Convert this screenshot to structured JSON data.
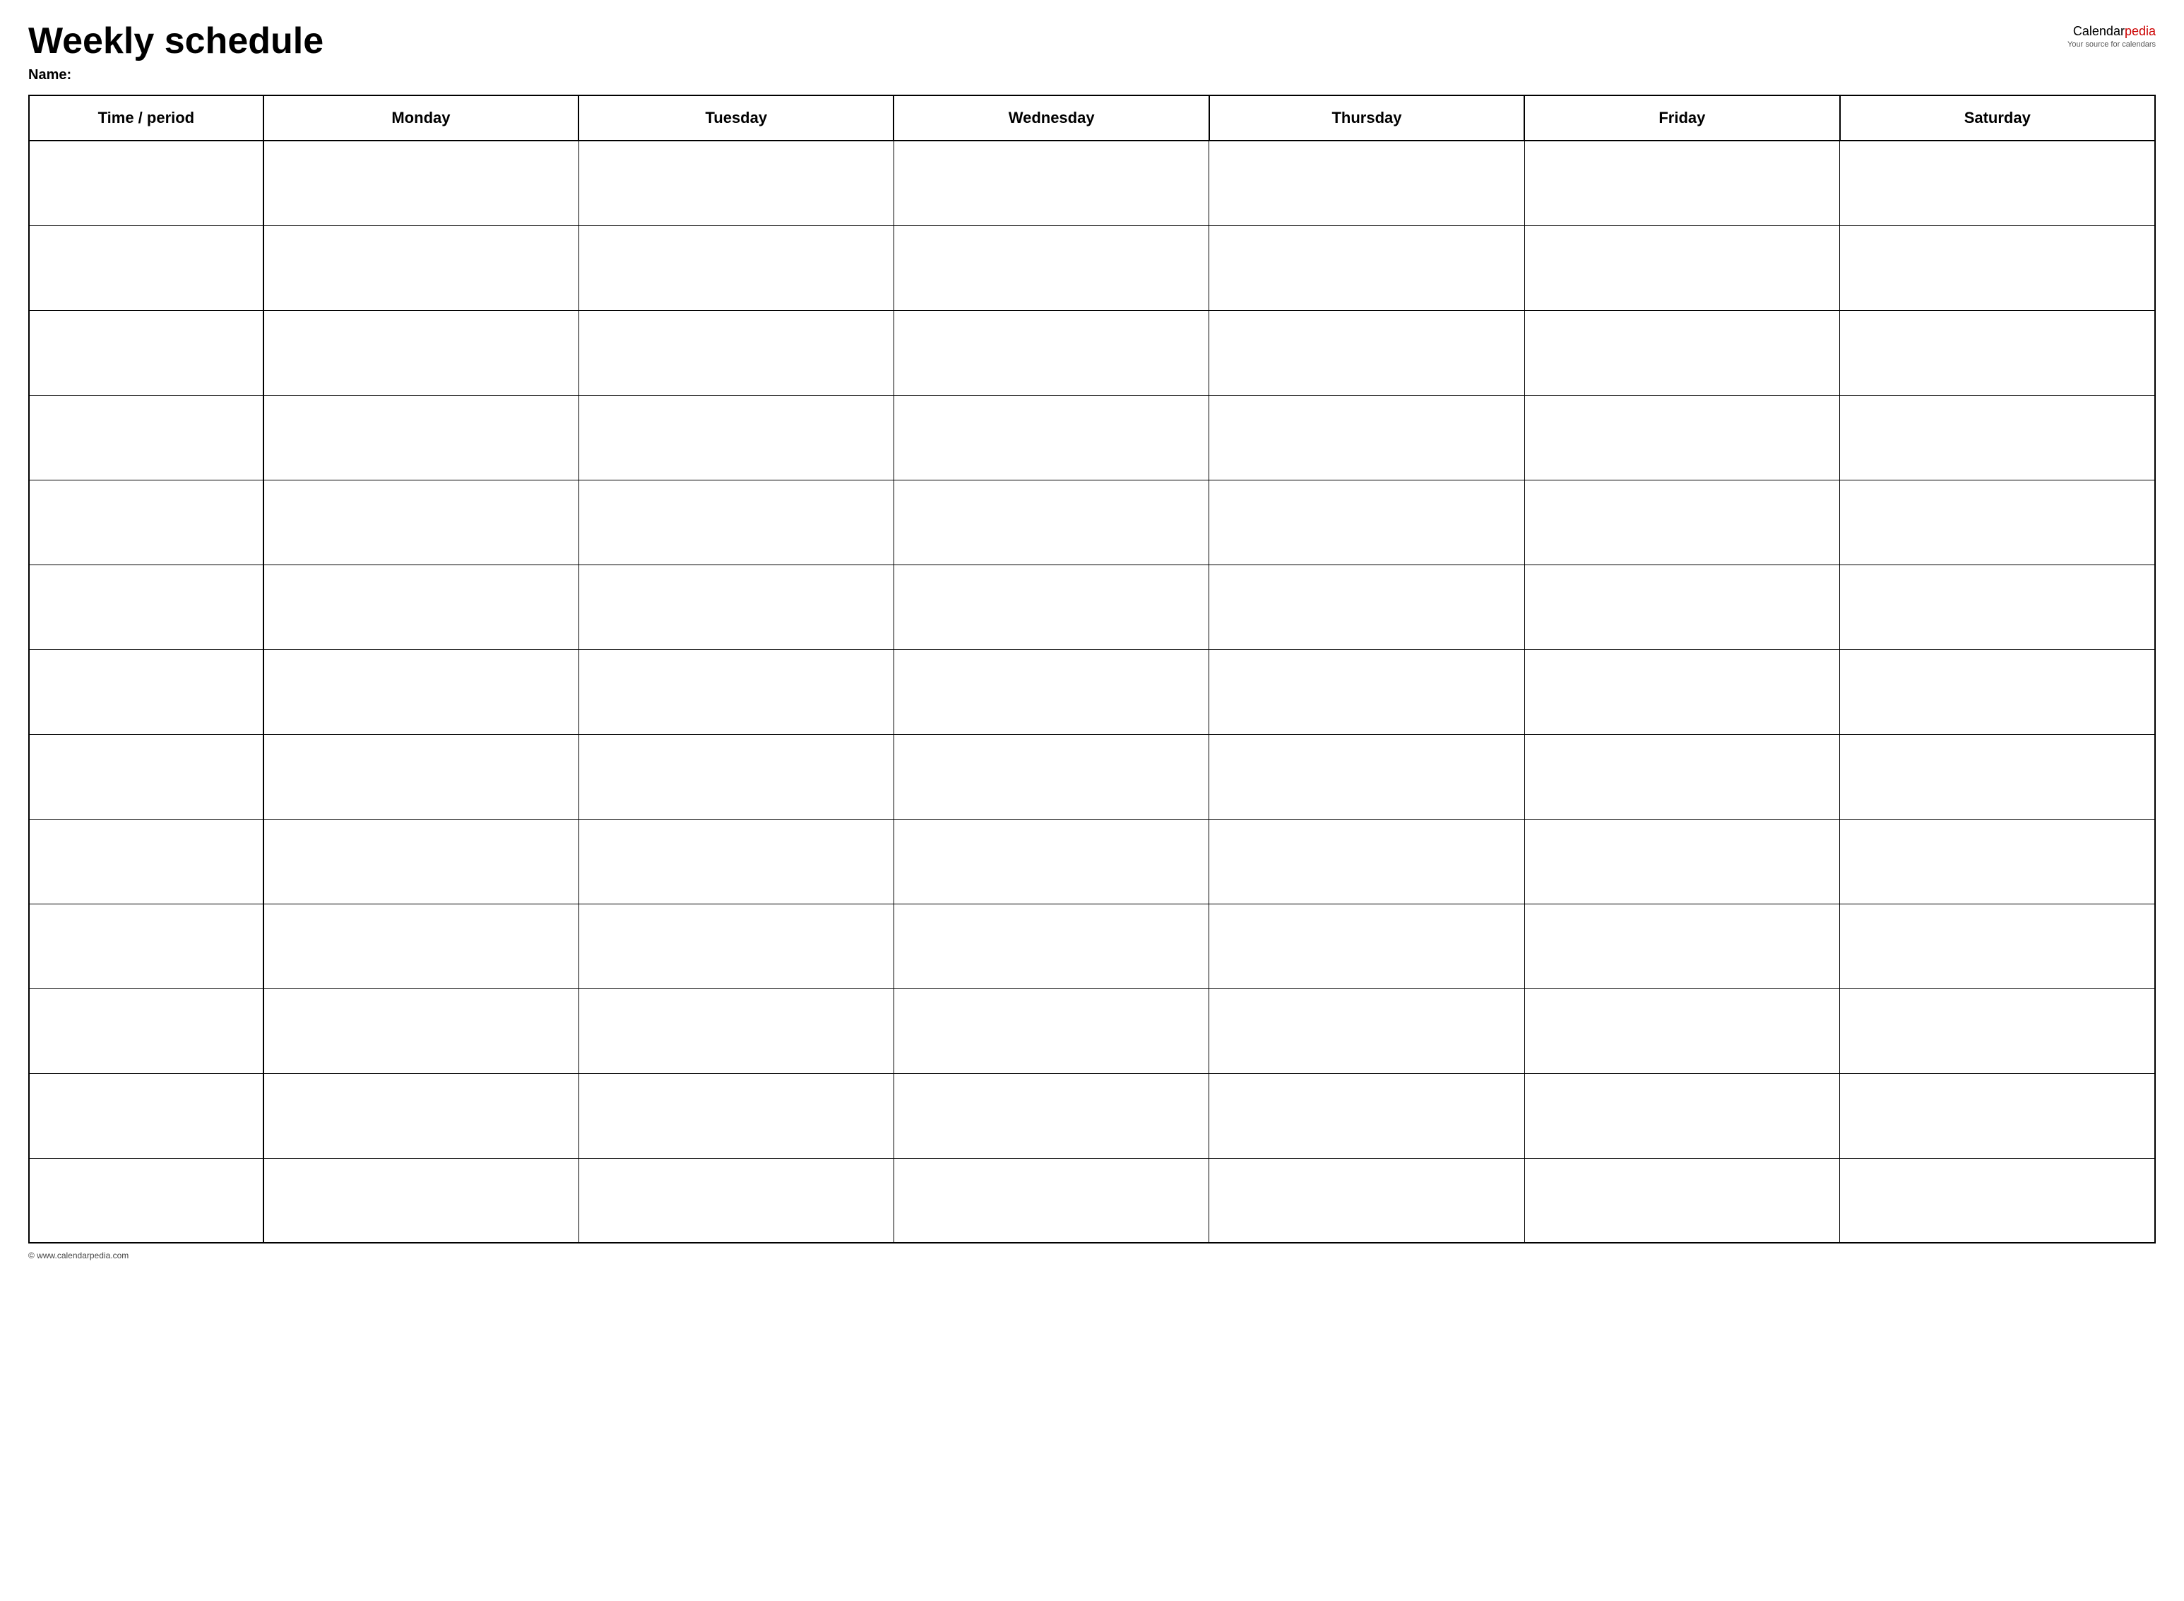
{
  "page": {
    "title": "Weekly schedule",
    "name_label": "Name:",
    "footer": "© www.calendarpedia.com"
  },
  "logo": {
    "brand": "Calendar",
    "brand_accent": "pedia",
    "subtitle": "Your source for calendars"
  },
  "table": {
    "headers": [
      {
        "id": "time",
        "label": "Time / period"
      },
      {
        "id": "monday",
        "label": "Monday"
      },
      {
        "id": "tuesday",
        "label": "Tuesday"
      },
      {
        "id": "wednesday",
        "label": "Wednesday"
      },
      {
        "id": "thursday",
        "label": "Thursday"
      },
      {
        "id": "friday",
        "label": "Friday"
      },
      {
        "id": "saturday",
        "label": "Saturday"
      }
    ],
    "row_count": 13
  }
}
